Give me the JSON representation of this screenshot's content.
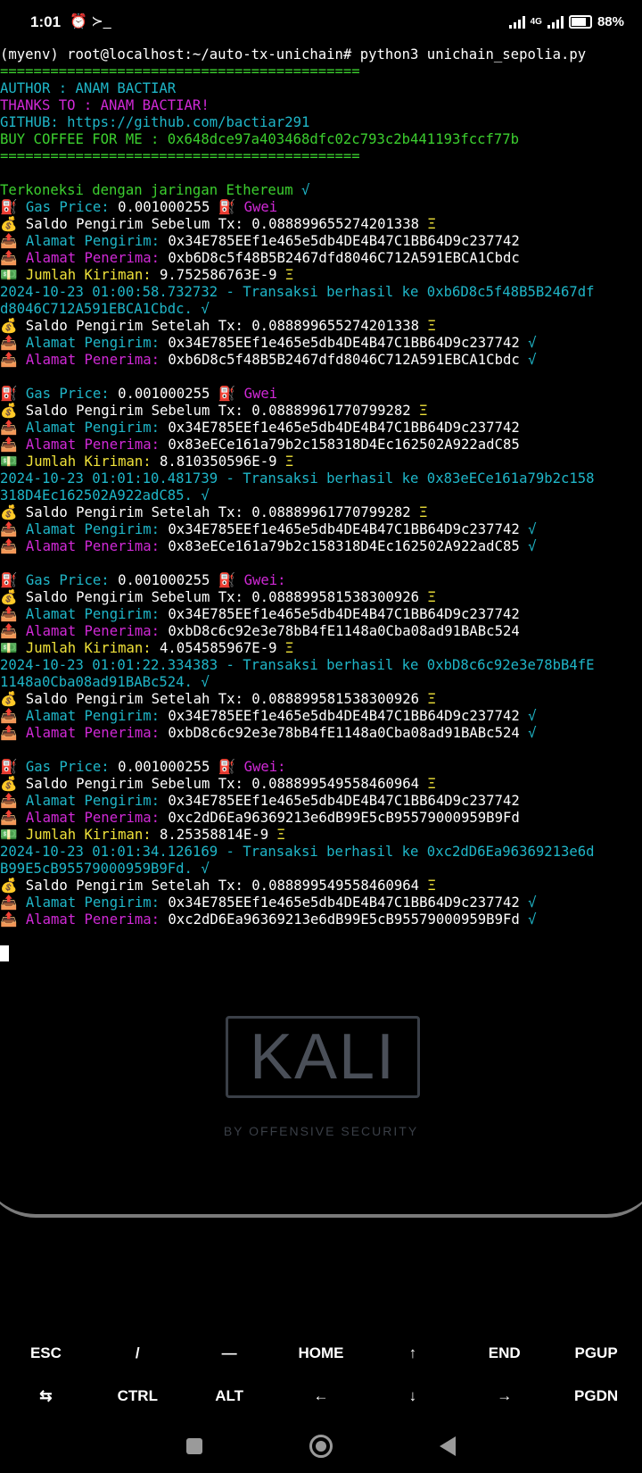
{
  "statusbar": {
    "time": "1:01",
    "icons_left": "⏰ ≻_",
    "network": "4G",
    "battery": "88%"
  },
  "terminal": {
    "lines": [
      [
        {
          "c": "white",
          "t": "(myenv) root@localhost:~/auto-tx-unichain# python3 unichain_sepolia.py"
        }
      ],
      [
        {
          "c": "green",
          "t": "==========================================="
        }
      ],
      [
        {
          "c": "cyan",
          "t": "AUTHOR : ANAM BACTIAR"
        }
      ],
      [
        {
          "c": "magenta",
          "t": "THANKS TO : ANAM BACTIAR!"
        }
      ],
      [
        {
          "c": "cyan",
          "t": "GITHUB: https://github.com/bactiar291"
        }
      ],
      [
        {
          "c": "green",
          "t": "BUY COFFEE FOR ME : 0x648dce97a403468dfc02c793c2b441193fccf77b"
        }
      ],
      [
        {
          "c": "green",
          "t": "==========================================="
        }
      ],
      [
        {
          "c": "white",
          "t": ""
        }
      ],
      [
        {
          "c": "green",
          "t": "Terkoneksi dengan jaringan Ethereum "
        },
        {
          "c": "cyan",
          "t": "√"
        }
      ],
      [
        {
          "c": "white",
          "t": "⛽ "
        },
        {
          "c": "cyan",
          "t": "Gas Price: "
        },
        {
          "c": "white",
          "t": "0.001000255 ⛽ "
        },
        {
          "c": "magenta",
          "t": "Gwei"
        }
      ],
      [
        {
          "c": "white",
          "t": "💰 Saldo Pengirim Sebelum Tx: 0.088899655274201338 "
        },
        {
          "c": "yellow",
          "t": "Ξ"
        }
      ],
      [
        {
          "c": "white",
          "t": "📤 "
        },
        {
          "c": "cyan",
          "t": "Alamat Pengirim: "
        },
        {
          "c": "white",
          "t": "0x34E785EEf1e465e5db4DE4B47C1BB64D9c237742"
        }
      ],
      [
        {
          "c": "white",
          "t": "📤 "
        },
        {
          "c": "magenta",
          "t": "Alamat Penerima: "
        },
        {
          "c": "white",
          "t": "0xb6D8c5f48B5B2467dfd8046C712A591EBCA1Cbdc"
        }
      ],
      [
        {
          "c": "white",
          "t": "💵 "
        },
        {
          "c": "yellow",
          "t": "Jumlah Kiriman: "
        },
        {
          "c": "white",
          "t": "9.752586763E-9 "
        },
        {
          "c": "yellow",
          "t": "Ξ"
        }
      ],
      [
        {
          "c": "ts",
          "t": "2024-10-23 01:00:58.732732 - Transaksi berhasil ke 0xb6D8c5f48B5B2467df"
        }
      ],
      [
        {
          "c": "ts",
          "t": "d8046C712A591EBCA1Cbdc. √"
        }
      ],
      [
        {
          "c": "white",
          "t": "💰 Saldo Pengirim Setelah Tx: 0.088899655274201338 "
        },
        {
          "c": "yellow",
          "t": "Ξ"
        }
      ],
      [
        {
          "c": "white",
          "t": "📤 "
        },
        {
          "c": "cyan",
          "t": "Alamat Pengirim: "
        },
        {
          "c": "white",
          "t": "0x34E785EEf1e465e5db4DE4B47C1BB64D9c237742 "
        },
        {
          "c": "cyan",
          "t": "√"
        }
      ],
      [
        {
          "c": "white",
          "t": "📤 "
        },
        {
          "c": "magenta",
          "t": "Alamat Penerima: "
        },
        {
          "c": "white",
          "t": "0xb6D8c5f48B5B2467dfd8046C712A591EBCA1Cbdc "
        },
        {
          "c": "cyan",
          "t": "√"
        }
      ],
      [
        {
          "c": "white",
          "t": ""
        }
      ],
      [
        {
          "c": "white",
          "t": "⛽ "
        },
        {
          "c": "cyan",
          "t": "Gas Price: "
        },
        {
          "c": "white",
          "t": "0.001000255 ⛽ "
        },
        {
          "c": "magenta",
          "t": "Gwei"
        }
      ],
      [
        {
          "c": "white",
          "t": "💰 Saldo Pengirim Sebelum Tx: 0.08889961770799282 "
        },
        {
          "c": "yellow",
          "t": "Ξ"
        }
      ],
      [
        {
          "c": "white",
          "t": "📤 "
        },
        {
          "c": "cyan",
          "t": "Alamat Pengirim: "
        },
        {
          "c": "white",
          "t": "0x34E785EEf1e465e5db4DE4B47C1BB64D9c237742"
        }
      ],
      [
        {
          "c": "white",
          "t": "📤 "
        },
        {
          "c": "magenta",
          "t": "Alamat Penerima: "
        },
        {
          "c": "white",
          "t": "0x83eECe161a79b2c158318D4Ec162502A922adC85"
        }
      ],
      [
        {
          "c": "white",
          "t": "💵 "
        },
        {
          "c": "yellow",
          "t": "Jumlah Kiriman: "
        },
        {
          "c": "white",
          "t": "8.810350596E-9 "
        },
        {
          "c": "yellow",
          "t": "Ξ"
        }
      ],
      [
        {
          "c": "ts",
          "t": "2024-10-23 01:01:10.481739 - Transaksi berhasil ke 0x83eECe161a79b2c158"
        }
      ],
      [
        {
          "c": "ts",
          "t": "318D4Ec162502A922adC85. √"
        }
      ],
      [
        {
          "c": "white",
          "t": "💰 Saldo Pengirim Setelah Tx: 0.08889961770799282 "
        },
        {
          "c": "yellow",
          "t": "Ξ"
        }
      ],
      [
        {
          "c": "white",
          "t": "📤 "
        },
        {
          "c": "cyan",
          "t": "Alamat Pengirim: "
        },
        {
          "c": "white",
          "t": "0x34E785EEf1e465e5db4DE4B47C1BB64D9c237742 "
        },
        {
          "c": "cyan",
          "t": "√"
        }
      ],
      [
        {
          "c": "white",
          "t": "📤 "
        },
        {
          "c": "magenta",
          "t": "Alamat Penerima: "
        },
        {
          "c": "white",
          "t": "0x83eECe161a79b2c158318D4Ec162502A922adC85 "
        },
        {
          "c": "cyan",
          "t": "√"
        }
      ],
      [
        {
          "c": "white",
          "t": ""
        }
      ],
      [
        {
          "c": "white",
          "t": "⛽ "
        },
        {
          "c": "cyan",
          "t": "Gas Price: "
        },
        {
          "c": "white",
          "t": "0.001000255 ⛽ "
        },
        {
          "c": "magenta",
          "t": "Gwei:"
        }
      ],
      [
        {
          "c": "white",
          "t": "💰 Saldo Pengirim Sebelum Tx: 0.088899581538300926 "
        },
        {
          "c": "yellow",
          "t": "Ξ"
        }
      ],
      [
        {
          "c": "white",
          "t": "📤 "
        },
        {
          "c": "cyan",
          "t": "Alamat Pengirim: "
        },
        {
          "c": "white",
          "t": "0x34E785EEf1e465e5db4DE4B47C1BB64D9c237742"
        }
      ],
      [
        {
          "c": "white",
          "t": "📤 "
        },
        {
          "c": "magenta",
          "t": "Alamat Penerima: "
        },
        {
          "c": "white",
          "t": "0xbD8c6c92e3e78bB4fE1148a0Cba08ad91BABc524"
        }
      ],
      [
        {
          "c": "white",
          "t": "💵 "
        },
        {
          "c": "yellow",
          "t": "Jumlah Kiriman: "
        },
        {
          "c": "white",
          "t": "4.054585967E-9 "
        },
        {
          "c": "yellow",
          "t": "Ξ"
        }
      ],
      [
        {
          "c": "ts",
          "t": "2024-10-23 01:01:22.334383 - Transaksi berhasil ke 0xbD8c6c92e3e78bB4fE"
        }
      ],
      [
        {
          "c": "ts",
          "t": "1148a0Cba08ad91BABc524. √"
        }
      ],
      [
        {
          "c": "white",
          "t": "💰 Saldo Pengirim Setelah Tx: 0.088899581538300926 "
        },
        {
          "c": "yellow",
          "t": "Ξ"
        }
      ],
      [
        {
          "c": "white",
          "t": "📤 "
        },
        {
          "c": "cyan",
          "t": "Alamat Pengirim: "
        },
        {
          "c": "white",
          "t": "0x34E785EEf1e465e5db4DE4B47C1BB64D9c237742 "
        },
        {
          "c": "cyan",
          "t": "√"
        }
      ],
      [
        {
          "c": "white",
          "t": "📤 "
        },
        {
          "c": "magenta",
          "t": "Alamat Penerima: "
        },
        {
          "c": "white",
          "t": "0xbD8c6c92e3e78bB4fE1148a0Cba08ad91BABc524 "
        },
        {
          "c": "cyan",
          "t": "√"
        }
      ],
      [
        {
          "c": "white",
          "t": ""
        }
      ],
      [
        {
          "c": "white",
          "t": "⛽ "
        },
        {
          "c": "cyan",
          "t": "Gas Price: "
        },
        {
          "c": "white",
          "t": "0.001000255 ⛽ "
        },
        {
          "c": "magenta",
          "t": "Gwei:"
        }
      ],
      [
        {
          "c": "white",
          "t": "💰 Saldo Pengirim Sebelum Tx: 0.088899549558460964 "
        },
        {
          "c": "yellow",
          "t": "Ξ"
        }
      ],
      [
        {
          "c": "white",
          "t": "📤 "
        },
        {
          "c": "cyan",
          "t": "Alamat Pengirim: "
        },
        {
          "c": "white",
          "t": "0x34E785EEf1e465e5db4DE4B47C1BB64D9c237742"
        }
      ],
      [
        {
          "c": "white",
          "t": "📤 "
        },
        {
          "c": "magenta",
          "t": "Alamat Penerima: "
        },
        {
          "c": "white",
          "t": "0xc2dD6Ea96369213e6dB99E5cB95579000959B9Fd"
        }
      ],
      [
        {
          "c": "white",
          "t": "💵 "
        },
        {
          "c": "yellow",
          "t": "Jumlah Kiriman: "
        },
        {
          "c": "white",
          "t": "8.25358814E-9 "
        },
        {
          "c": "yellow",
          "t": "Ξ"
        }
      ],
      [
        {
          "c": "ts",
          "t": "2024-10-23 01:01:34.126169 - Transaksi berhasil ke 0xc2dD6Ea96369213e6d"
        }
      ],
      [
        {
          "c": "ts",
          "t": "B99E5cB95579000959B9Fd. √"
        }
      ],
      [
        {
          "c": "white",
          "t": "💰 Saldo Pengirim Setelah Tx: 0.088899549558460964 "
        },
        {
          "c": "yellow",
          "t": "Ξ"
        }
      ],
      [
        {
          "c": "white",
          "t": "📤 "
        },
        {
          "c": "cyan",
          "t": "Alamat Pengirim: "
        },
        {
          "c": "white",
          "t": "0x34E785EEf1e465e5db4DE4B47C1BB64D9c237742 "
        },
        {
          "c": "cyan",
          "t": "√"
        }
      ],
      [
        {
          "c": "white",
          "t": "📤 "
        },
        {
          "c": "magenta",
          "t": "Alamat Penerima: "
        },
        {
          "c": "white",
          "t": "0xc2dD6Ea96369213e6dB99E5cB95579000959B9Fd "
        },
        {
          "c": "cyan",
          "t": "√"
        }
      ]
    ]
  },
  "wallpaper": {
    "logo_text": "KALI",
    "logo_subtitle": "BY OFFENSIVE SECURITY"
  },
  "extra_keys": {
    "row1": [
      "ESC",
      "/",
      "—",
      "HOME",
      "↑",
      "END",
      "PGUP"
    ],
    "row2": [
      "⇆",
      "CTRL",
      "ALT",
      "←",
      "↓",
      "→",
      "PGDN"
    ]
  },
  "colors": {
    "background": "#000000",
    "cyan": "#1fb6c8",
    "magenta": "#d029d6",
    "green": "#3ccf2f",
    "yellow": "#f0e23a"
  }
}
